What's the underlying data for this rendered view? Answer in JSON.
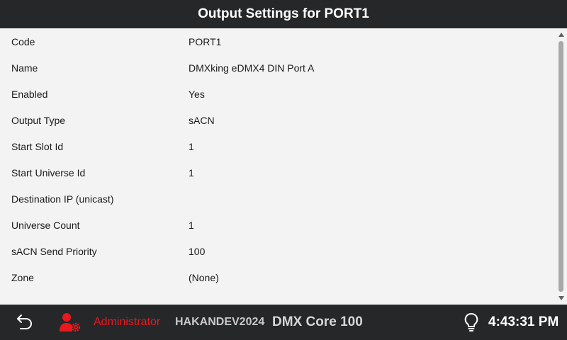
{
  "header": {
    "title": "Output Settings for PORT1"
  },
  "settings": [
    {
      "label": "Code",
      "value": "PORT1"
    },
    {
      "label": "Name",
      "value": "DMXking eDMX4 DIN Port A"
    },
    {
      "label": "Enabled",
      "value": "Yes"
    },
    {
      "label": "Output Type",
      "value": "sACN"
    },
    {
      "label": "Start Slot Id",
      "value": "1"
    },
    {
      "label": "Start Universe Id",
      "value": "1"
    },
    {
      "label": "Destination IP (unicast)",
      "value": ""
    },
    {
      "label": "Universe Count",
      "value": "1"
    },
    {
      "label": "sACN Send Priority",
      "value": "100"
    },
    {
      "label": "Zone",
      "value": "(None)"
    }
  ],
  "footer": {
    "back_icon": "back-arrow-icon",
    "user_icon": "user-gear-icon",
    "user_role": "Administrator",
    "host_name": "HAKANDEV2024",
    "device_name": "DMX Core 100",
    "bulb_icon": "lightbulb-icon",
    "time": "4:43:31 PM"
  },
  "colors": {
    "bar_background": "#262729",
    "content_background": "#f3f3f3",
    "admin_red": "#e8191f"
  }
}
